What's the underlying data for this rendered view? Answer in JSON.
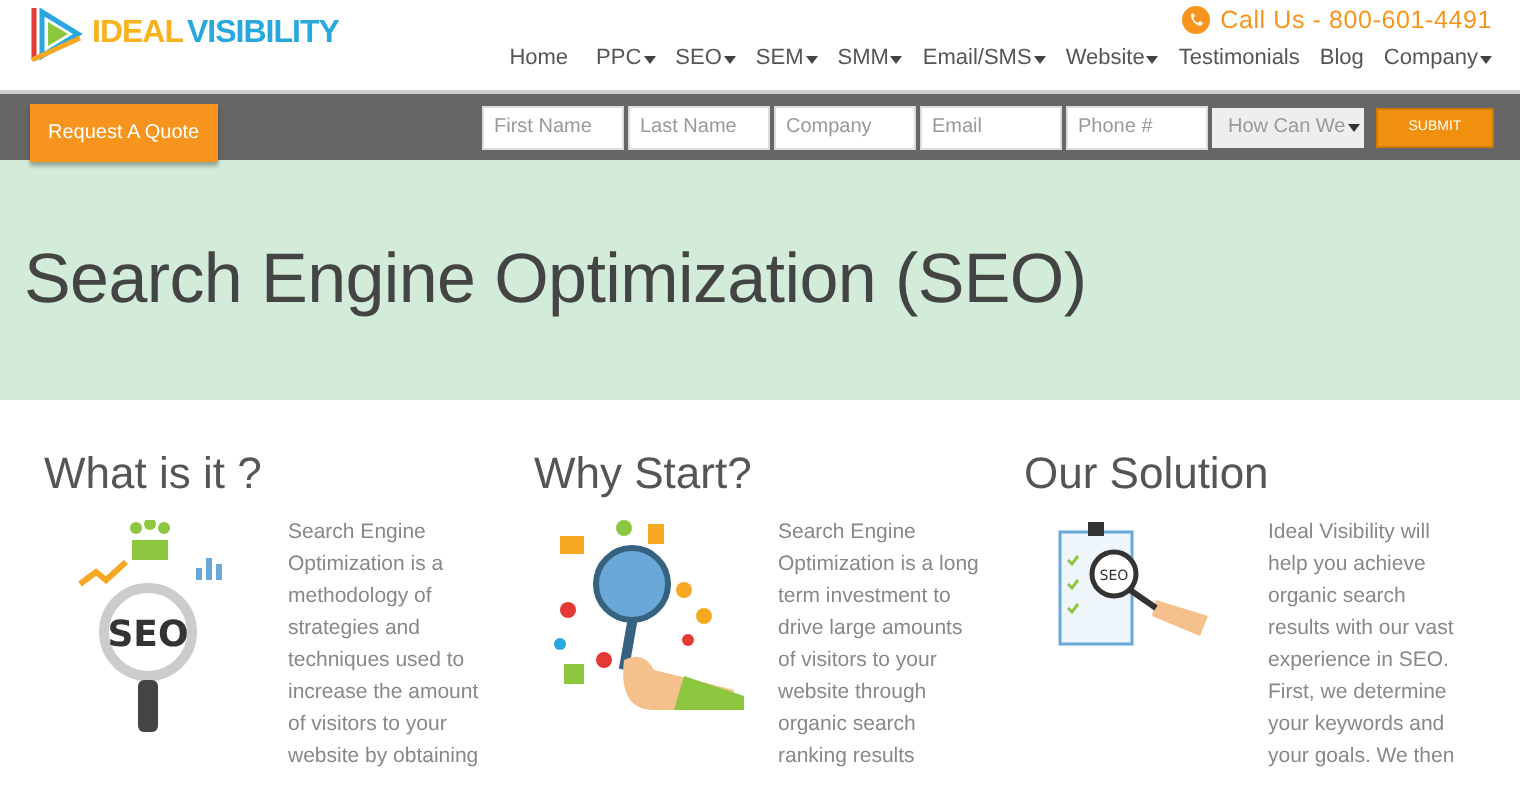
{
  "logo": {
    "part_1": "IDEAL",
    "part_2": "VISIBILITY"
  },
  "call": "Call Us - 800-601-4491",
  "nav": [
    {
      "label": "Home",
      "dropdown": false
    },
    {
      "label": "PPC",
      "dropdown": true
    },
    {
      "label": "SEO",
      "dropdown": true
    },
    {
      "label": "SEM",
      "dropdown": true
    },
    {
      "label": "SMM",
      "dropdown": true
    },
    {
      "label": "Email/SMS",
      "dropdown": true
    },
    {
      "label": "Website",
      "dropdown": true
    },
    {
      "label": "Testimonials",
      "dropdown": false
    },
    {
      "label": "Blog",
      "dropdown": false
    },
    {
      "label": "Company",
      "dropdown": true
    }
  ],
  "quote_button": "Request A Quote",
  "form": {
    "fields": [
      {
        "placeholder": "First Name"
      },
      {
        "placeholder": "Last Name"
      },
      {
        "placeholder": "Company"
      },
      {
        "placeholder": "Email"
      },
      {
        "placeholder": "Phone #"
      }
    ],
    "select": "How Can We",
    "submit": "SUBMIT"
  },
  "hero": {
    "title": "Search Engine Optimization (SEO)"
  },
  "sections": [
    {
      "kind": "seo",
      "art_text": "SEO",
      "heading": "What is it ?",
      "text": "Search Engine Optimization is a methodology of strategies and techniques used to increase the amount of visitors to your website by obtaining"
    },
    {
      "kind": "hand",
      "heading": "Why Start?",
      "text": "Search Engine Optimization is a long term investment to drive large amounts of visitors to your website through organic search ranking results"
    },
    {
      "kind": "clipboard",
      "art_text": "SEO",
      "heading": "Our Solution",
      "text": "Ideal Visibility will help you achieve organic search results with our vast experience in SEO. First, we determine your keywords and your goals. We then"
    }
  ]
}
